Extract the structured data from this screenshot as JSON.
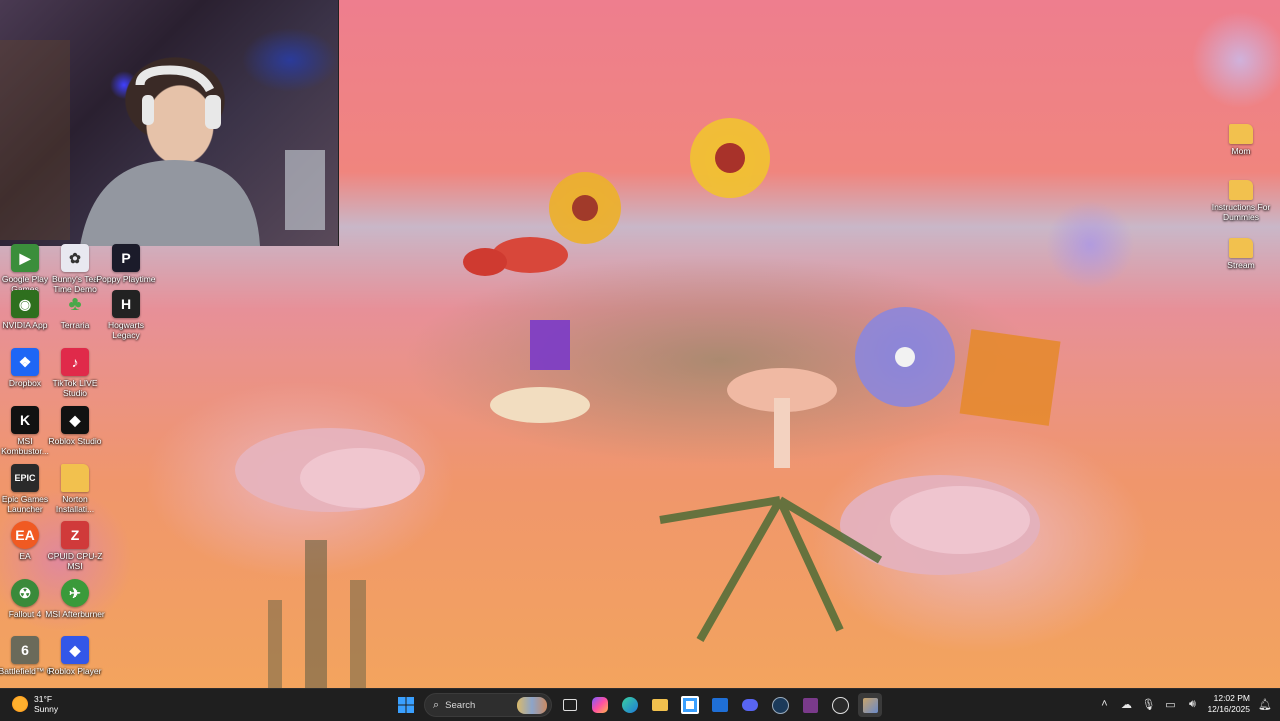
{
  "left_icons": [
    {
      "label": "Google Play Games",
      "icon": "google-play-games-icon",
      "color": "#3b8e3b"
    },
    {
      "label": "Bunny's Tea Time Demo",
      "icon": "bunny-tea-time-icon",
      "color": "#e8e8f0"
    },
    {
      "label": "Poppy Playtime",
      "icon": "poppy-playtime-icon",
      "color": "#1b1b2a"
    },
    {
      "label": "NVIDIA App",
      "icon": "nvidia-app-icon",
      "color": "#2e6f1e"
    },
    {
      "label": "Terraria",
      "icon": "terraria-icon",
      "color": "#4aa84a"
    },
    {
      "label": "Hogwarts Legacy",
      "icon": "hogwarts-legacy-icon",
      "color": "#222"
    },
    {
      "label": "Dropbox",
      "icon": "dropbox-icon",
      "color": "#1e66f5"
    },
    {
      "label": "TikTok LIVE Studio",
      "icon": "tiktok-live-icon",
      "color": "#e02a4a"
    },
    {
      "label": "MSI Kombustor...",
      "icon": "msi-kombustor-icon",
      "color": "#111"
    },
    {
      "label": "Roblox Studio",
      "icon": "roblox-studio-icon",
      "color": "#111"
    },
    {
      "label": "Epic Games Launcher",
      "icon": "epic-games-icon",
      "color": "#2a2a2a"
    },
    {
      "label": "Norton Installati...",
      "icon": "folder-icon",
      "color": "#f2c14e"
    },
    {
      "label": "EA",
      "icon": "ea-icon",
      "color": "#f05a22"
    },
    {
      "label": "CPUID CPU-Z MSI",
      "icon": "cpu-z-icon",
      "color": "#d03a3a"
    },
    {
      "label": "Fallout 4",
      "icon": "fallout-4-icon",
      "color": "#3a8a3a"
    },
    {
      "label": "MSI Afterburner",
      "icon": "msi-afterburner-icon",
      "color": "#3a9a3a"
    },
    {
      "label": "Battlefield™ 6",
      "icon": "battlefield-6-icon",
      "color": "#6a6a5a"
    },
    {
      "label": "Roblox Player",
      "icon": "roblox-player-icon",
      "color": "#3357e8"
    }
  ],
  "right_icons": [
    {
      "label": "Mom",
      "icon": "folder-icon",
      "color": "#f2c14e"
    },
    {
      "label": "Instructions For Dummies",
      "icon": "folder-icon",
      "color": "#f2c14e"
    },
    {
      "label": "Stream",
      "icon": "stream-icon",
      "color": "#f2c14e"
    }
  ],
  "taskbar": {
    "weather_temp": "31°F",
    "weather_cond": "Sunny",
    "search_label": "Search",
    "time": "12:02 PM",
    "date": "12/16/2025"
  }
}
